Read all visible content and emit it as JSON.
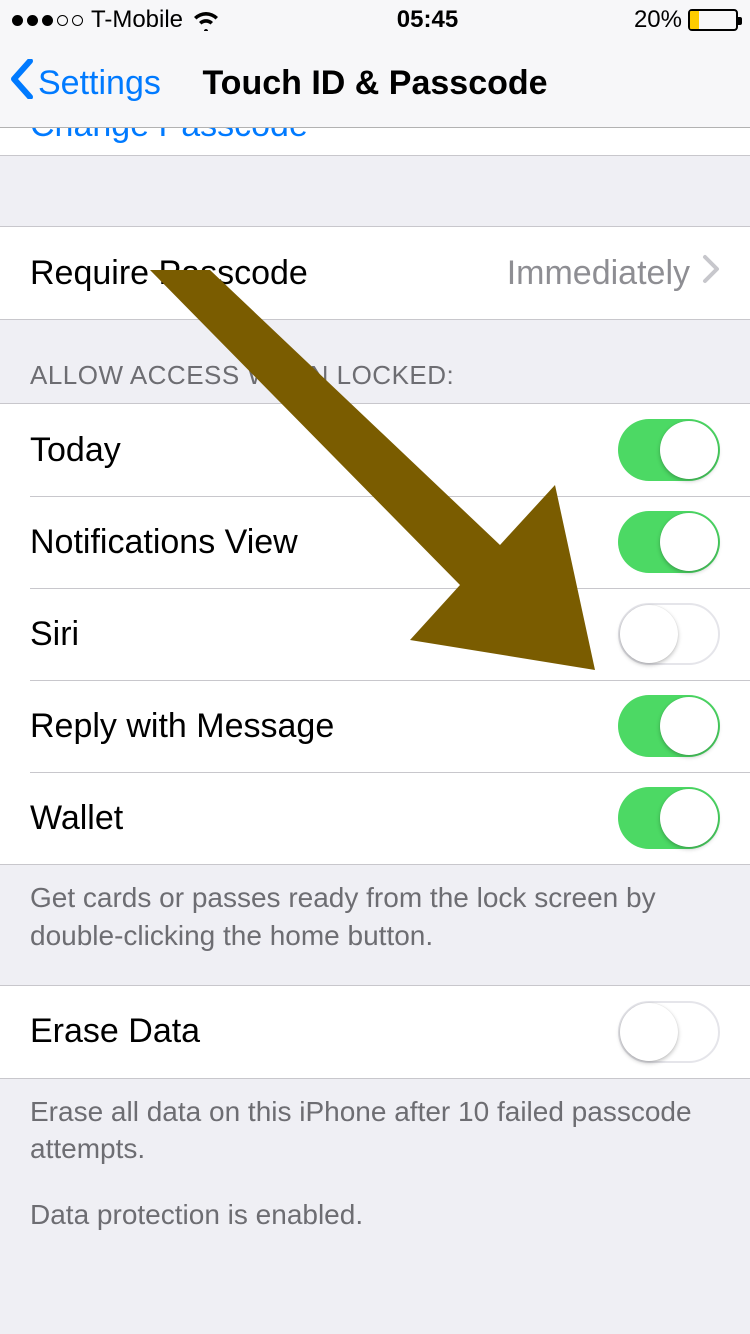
{
  "status": {
    "carrier": "T-Mobile",
    "time": "05:45",
    "battery_pct": "20%",
    "battery_level": 0.2,
    "battery_color": "#ffcc00",
    "signal_dots_filled": 3,
    "signal_dots_total": 5
  },
  "nav": {
    "back_label": "Settings",
    "title": "Touch ID & Passcode"
  },
  "partial_row": {
    "text": "Change Passcode"
  },
  "require": {
    "label": "Require Passcode",
    "value": "Immediately"
  },
  "allow_header": "ALLOW ACCESS WHEN LOCKED:",
  "toggles": [
    {
      "label": "Today",
      "on": true
    },
    {
      "label": "Notifications View",
      "on": true
    },
    {
      "label": "Siri",
      "on": false
    },
    {
      "label": "Reply with Message",
      "on": true
    },
    {
      "label": "Wallet",
      "on": true
    }
  ],
  "wallet_footer": "Get cards or passes ready from the lock screen by double-clicking the home button.",
  "erase": {
    "label": "Erase Data",
    "on": false,
    "footer1": "Erase all data on this iPhone after 10 failed passcode attempts.",
    "footer2": "Data protection is enabled."
  },
  "annotation": {
    "arrow_color": "#7a5c00"
  }
}
